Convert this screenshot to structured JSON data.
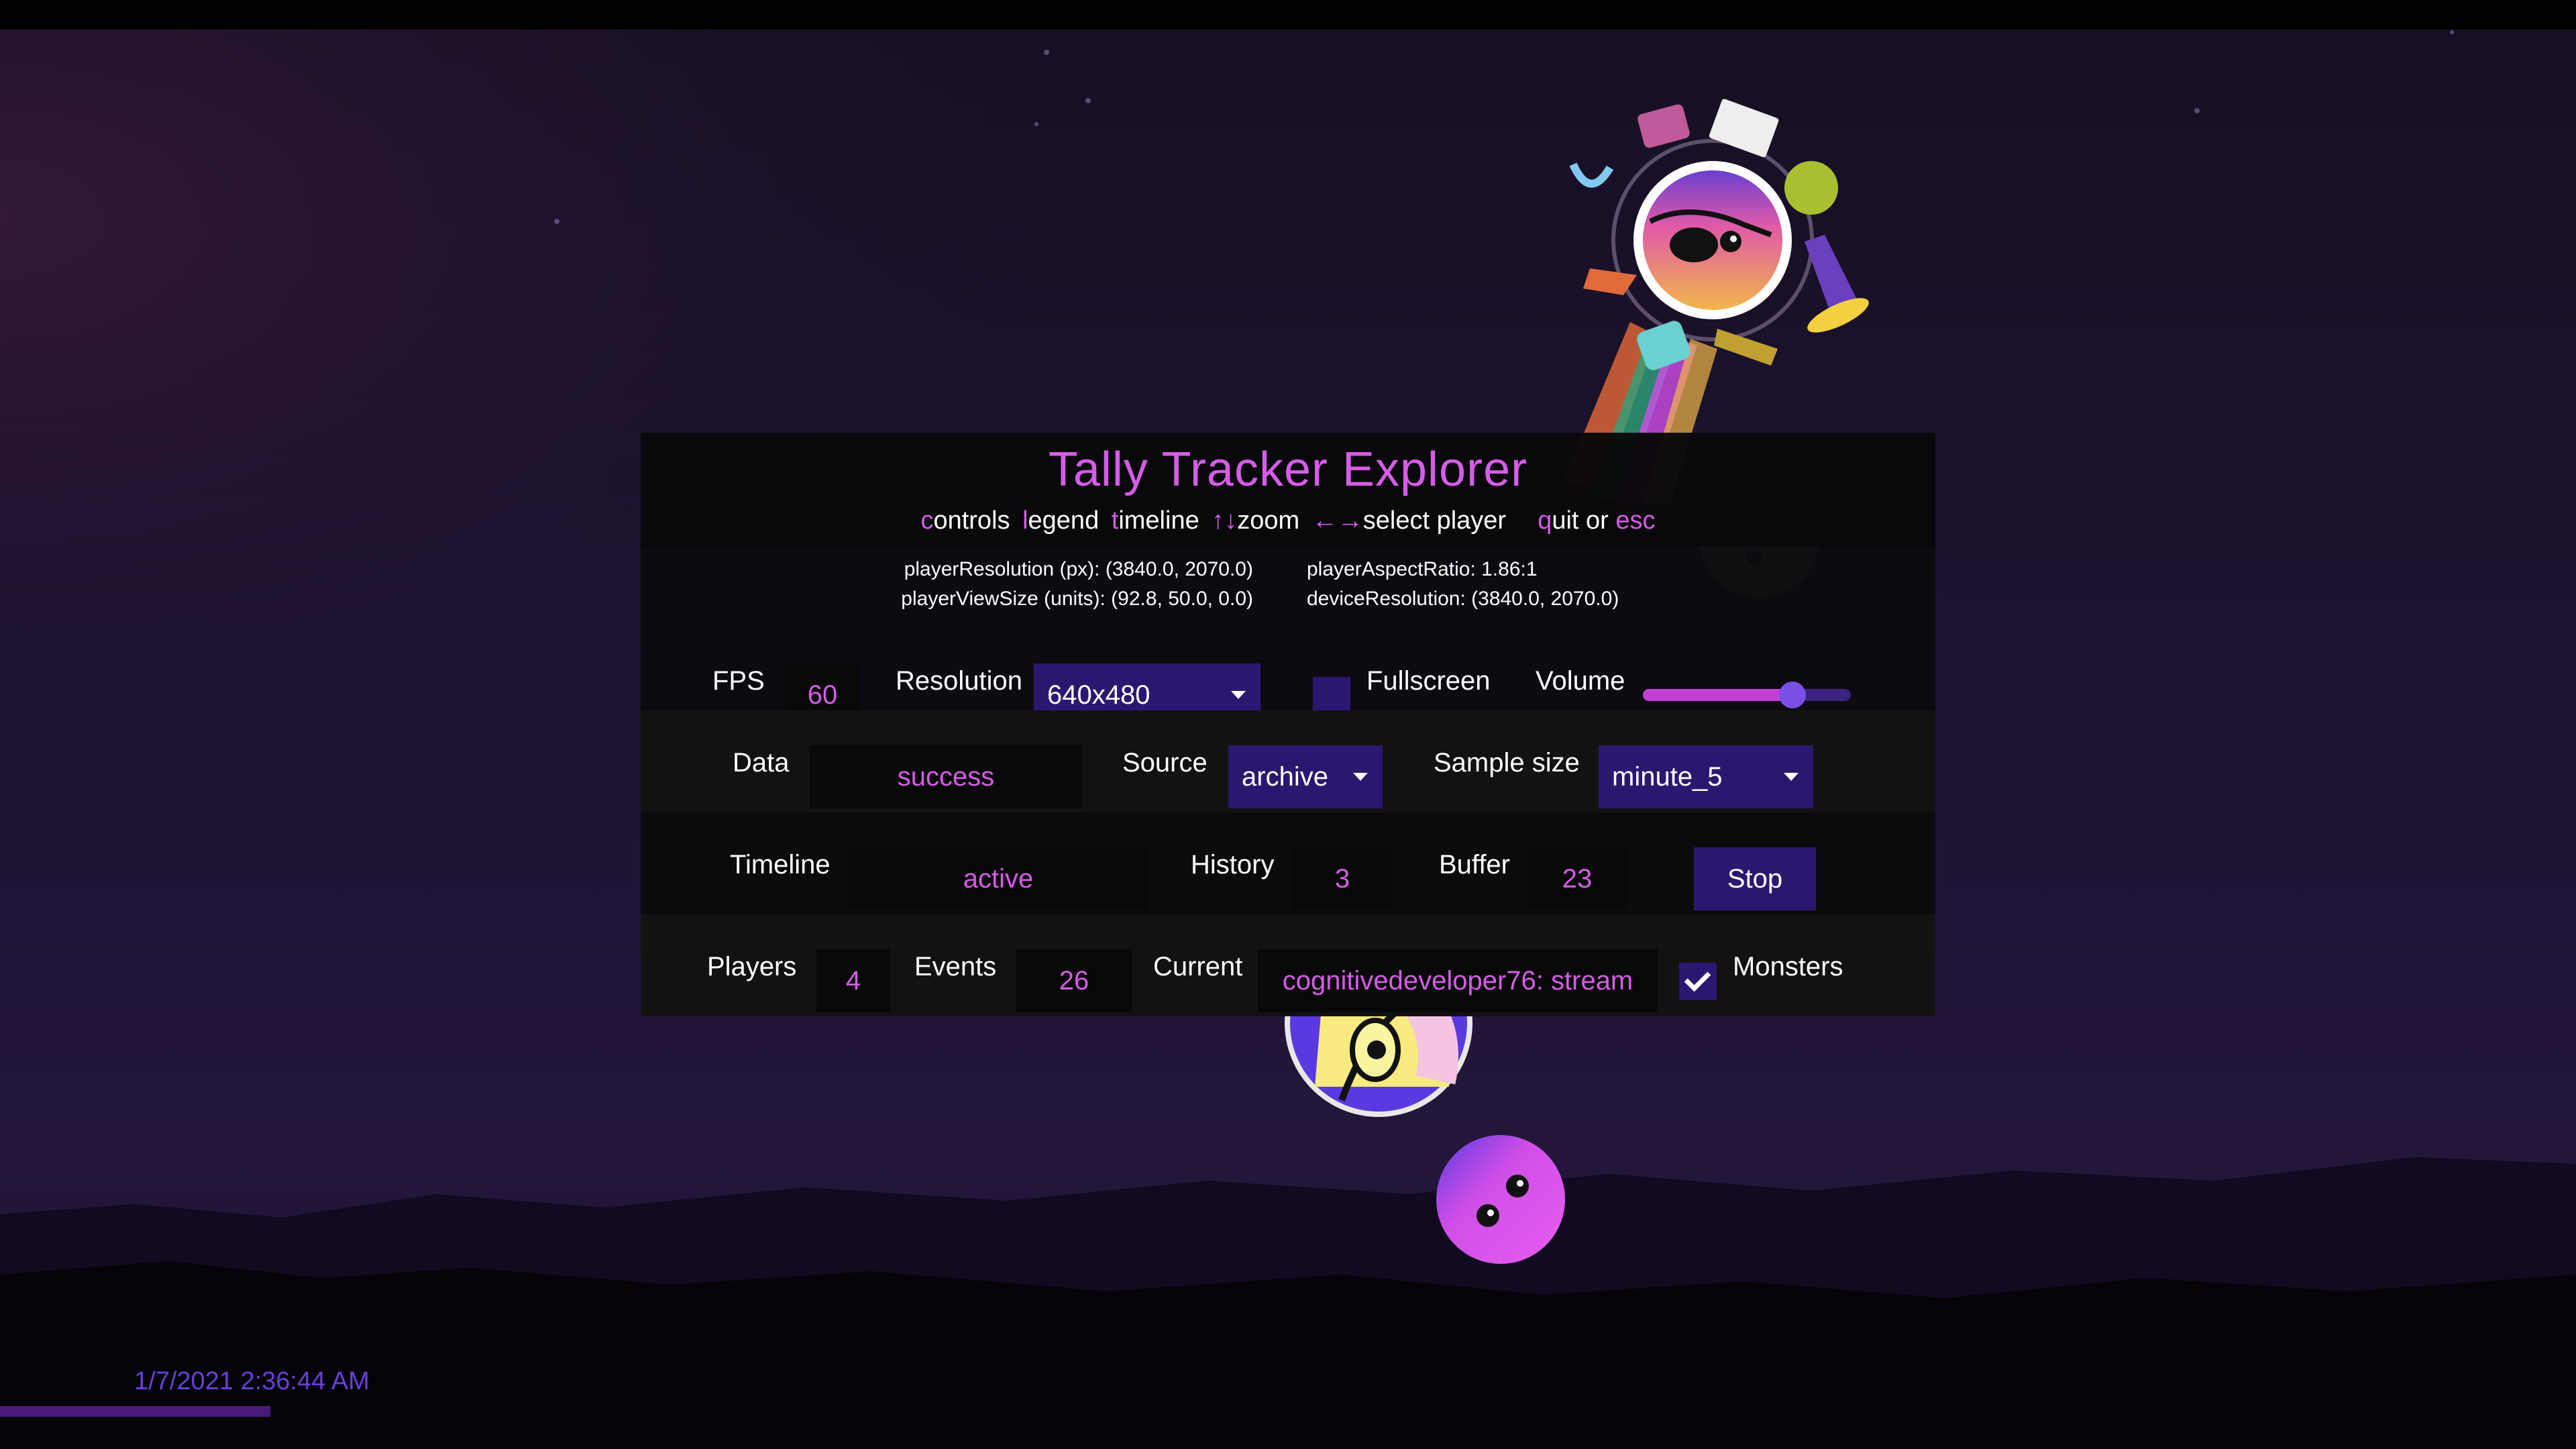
{
  "app": {
    "title": "Tally Tracker Explorer"
  },
  "menu": {
    "items": [
      {
        "key": "c",
        "rest": "ontrols"
      },
      {
        "key": "l",
        "rest": "egend"
      },
      {
        "key": "t",
        "rest": "imeline"
      },
      {
        "key": "↑↓",
        "rest": "zoom"
      },
      {
        "key": "←→",
        "rest": "select player"
      },
      {
        "key": "q",
        "rest": "uit or "
      },
      {
        "key": "esc",
        "rest": ""
      }
    ]
  },
  "info": {
    "player_resolution": "playerResolution (px): (3840.0, 2070.0)",
    "player_view_size": "playerViewSize (units): (92.8, 50.0, 0.0)",
    "player_aspect_ratio": "playerAspectRatio: 1.86:1",
    "device_resolution": "deviceResolution: (3840.0, 2070.0)"
  },
  "controls": {
    "fps_label": "FPS",
    "fps_value": "60",
    "resolution_label": "Resolution",
    "resolution_value": "640x480",
    "fullscreen_label": "Fullscreen",
    "fullscreen_checked": false,
    "volume_label": "Volume",
    "volume_level": 0.72,
    "data_label": "Data",
    "data_value": "success",
    "source_label": "Source",
    "source_value": "archive",
    "sample_size_label": "Sample size",
    "sample_size_value": "minute_5",
    "timeline_label": "Timeline",
    "timeline_value": "active",
    "history_label": "History",
    "history_value": "3",
    "buffer_label": "Buffer",
    "buffer_value": "23",
    "stop_label": "Stop",
    "players_label": "Players",
    "players_value": "4",
    "events_label": "Events",
    "events_value": "26",
    "current_label": "Current",
    "current_value": "cognitivedeveloper76: stream",
    "monsters_label": "Monsters",
    "monsters_checked": true
  },
  "status": {
    "timestamp": "1/7/2021 2:36:44 AM",
    "progress": 0.105
  },
  "colors": {
    "accent": "#d65ce8",
    "control_bg": "#2a1870",
    "timestamp": "#6a3fd8"
  }
}
